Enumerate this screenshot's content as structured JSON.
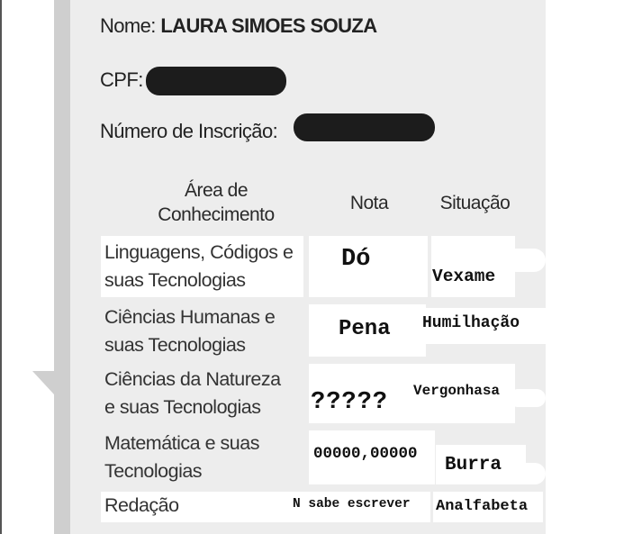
{
  "student": {
    "name_label": "Nome:",
    "name_value": "LAURA SIMOES SOUZA",
    "cpf_label": "CPF:",
    "inscricao_label": "Número de Inscrição:"
  },
  "table": {
    "headers": {
      "area": "Área de\nConhecimento",
      "nota": "Nota",
      "situacao": "Situação"
    },
    "rows": [
      {
        "area": "Linguagens, Códigos e\nsuas Tecnologias",
        "nota": "Dó",
        "situacao": "Vexame"
      },
      {
        "area": "Ciências Humanas e\nsuas Tecnologias",
        "nota": "Pena",
        "situacao": "Humilhação"
      },
      {
        "area": "Ciências da Natureza\ne suas Tecnologias",
        "nota": "?????",
        "situacao": "Vergonhasa"
      },
      {
        "area": "Matemática e suas\nTecnologias",
        "nota": "00000,00000",
        "situacao": "Burra"
      },
      {
        "area": "Redação",
        "nota": "N sabe escrever",
        "situacao": "Analfabeta"
      }
    ]
  }
}
